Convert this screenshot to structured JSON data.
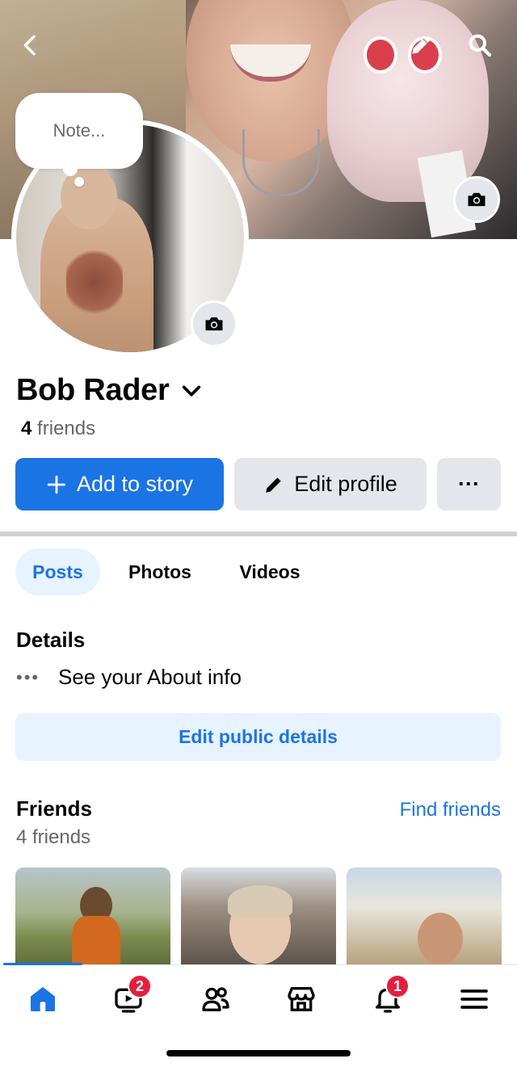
{
  "profile": {
    "name": "Bob Rader",
    "friend_count": "4",
    "friends_word": "friends",
    "note_placeholder": "Note..."
  },
  "actions": {
    "add_to_story": "Add to story",
    "edit_profile": "Edit profile",
    "more": "···"
  },
  "tabs": [
    {
      "label": "Posts",
      "active": true
    },
    {
      "label": "Photos",
      "active": false
    },
    {
      "label": "Videos",
      "active": false
    }
  ],
  "details": {
    "title": "Details",
    "about_text": "See your About info",
    "edit_button": "Edit public details"
  },
  "friends_section": {
    "title": "Friends",
    "find_link": "Find friends",
    "count_text": "4 friends"
  },
  "bottom_nav": {
    "items": [
      "home-icon",
      "video-icon",
      "friends-icon",
      "marketplace-icon",
      "notifications-icon",
      "menu-icon"
    ],
    "video_badge": "2",
    "notifications_badge": "1"
  },
  "colors": {
    "accent": "#1b74e4",
    "badge": "#e41e3f",
    "secondary_bg": "#e4e6eb",
    "accent_soft": "#e7f3ff"
  }
}
